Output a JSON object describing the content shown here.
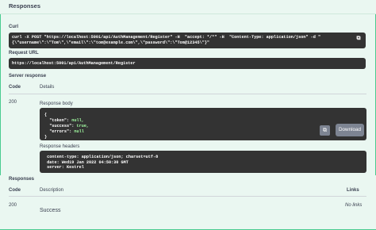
{
  "responses_title": "Responses",
  "curl": {
    "label": "Curl",
    "line1": "curl -X POST \"https://localhost:5001/api/AuthManagement/Register\" -H  \"accept: */*\" -H  \"Content-Type: application/json\" -d \"",
    "line2": "{\\\"username\\\":\\\"Tom\\\",\\\"email\\\":\\\"tom@example.com\\\",\\\"password\\\":\\\"Tom@12345\\\"}\"",
    "copy_icon": "copy-icon"
  },
  "request_url": {
    "label": "Request URL",
    "value": "https://localhost:5001/api/AuthManagement/Register"
  },
  "server_response": {
    "label": "Server response",
    "code_header": "Code",
    "details_header": "Details",
    "code": "200",
    "body_label": "Response body",
    "body_lines": [
      {
        "key": "{",
        "val": ""
      },
      {
        "key": "  \"token\": ",
        "val": "null,"
      },
      {
        "key": "  \"success\": ",
        "val": "true,"
      },
      {
        "key": "  \"errors\": ",
        "val": "null"
      },
      {
        "key": "}",
        "val": ""
      }
    ],
    "download_label": "Download",
    "headers_label": "Response headers",
    "header_lines": [
      " content-type: application/json; charset=utf-8 ",
      " date: Wed19 Jan 2022 04:50:30 GMT ",
      " server: Kestrel "
    ]
  },
  "responses": {
    "label": "Responses",
    "code_header": "Code",
    "description_header": "Description",
    "links_header": "Links",
    "rows": [
      {
        "code": "200",
        "description": "Success",
        "links": "No links"
      }
    ]
  },
  "colors": {
    "accent": "#49cc90",
    "panel_bg": "#eaf7f1",
    "code_bg": "#333333"
  }
}
